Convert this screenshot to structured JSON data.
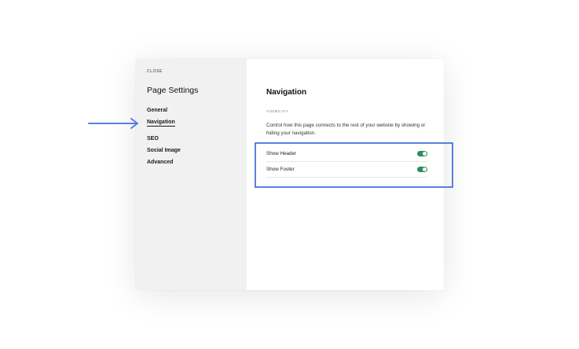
{
  "sidebar": {
    "close_label": "CLOSE",
    "title": "Page Settings",
    "items": [
      {
        "label": "General"
      },
      {
        "label": "Navigation",
        "active": true
      },
      {
        "label": "SEO"
      },
      {
        "label": "Social Image"
      },
      {
        "label": "Advanced"
      }
    ]
  },
  "content": {
    "title": "Navigation",
    "section_label": "VISIBILITY",
    "description": "Control how this page connects to the rest of your website by showing or hiding your navigation.",
    "settings": [
      {
        "label": "Show Header",
        "enabled": true
      },
      {
        "label": "Show Footer",
        "enabled": true
      }
    ]
  },
  "colors": {
    "toggle_on": "#2e8d5f",
    "annotation": "#5a7fe0",
    "sidebar_bg": "#f1f1f1"
  },
  "annotations": {
    "arrow_icon": "arrow-right-icon"
  }
}
